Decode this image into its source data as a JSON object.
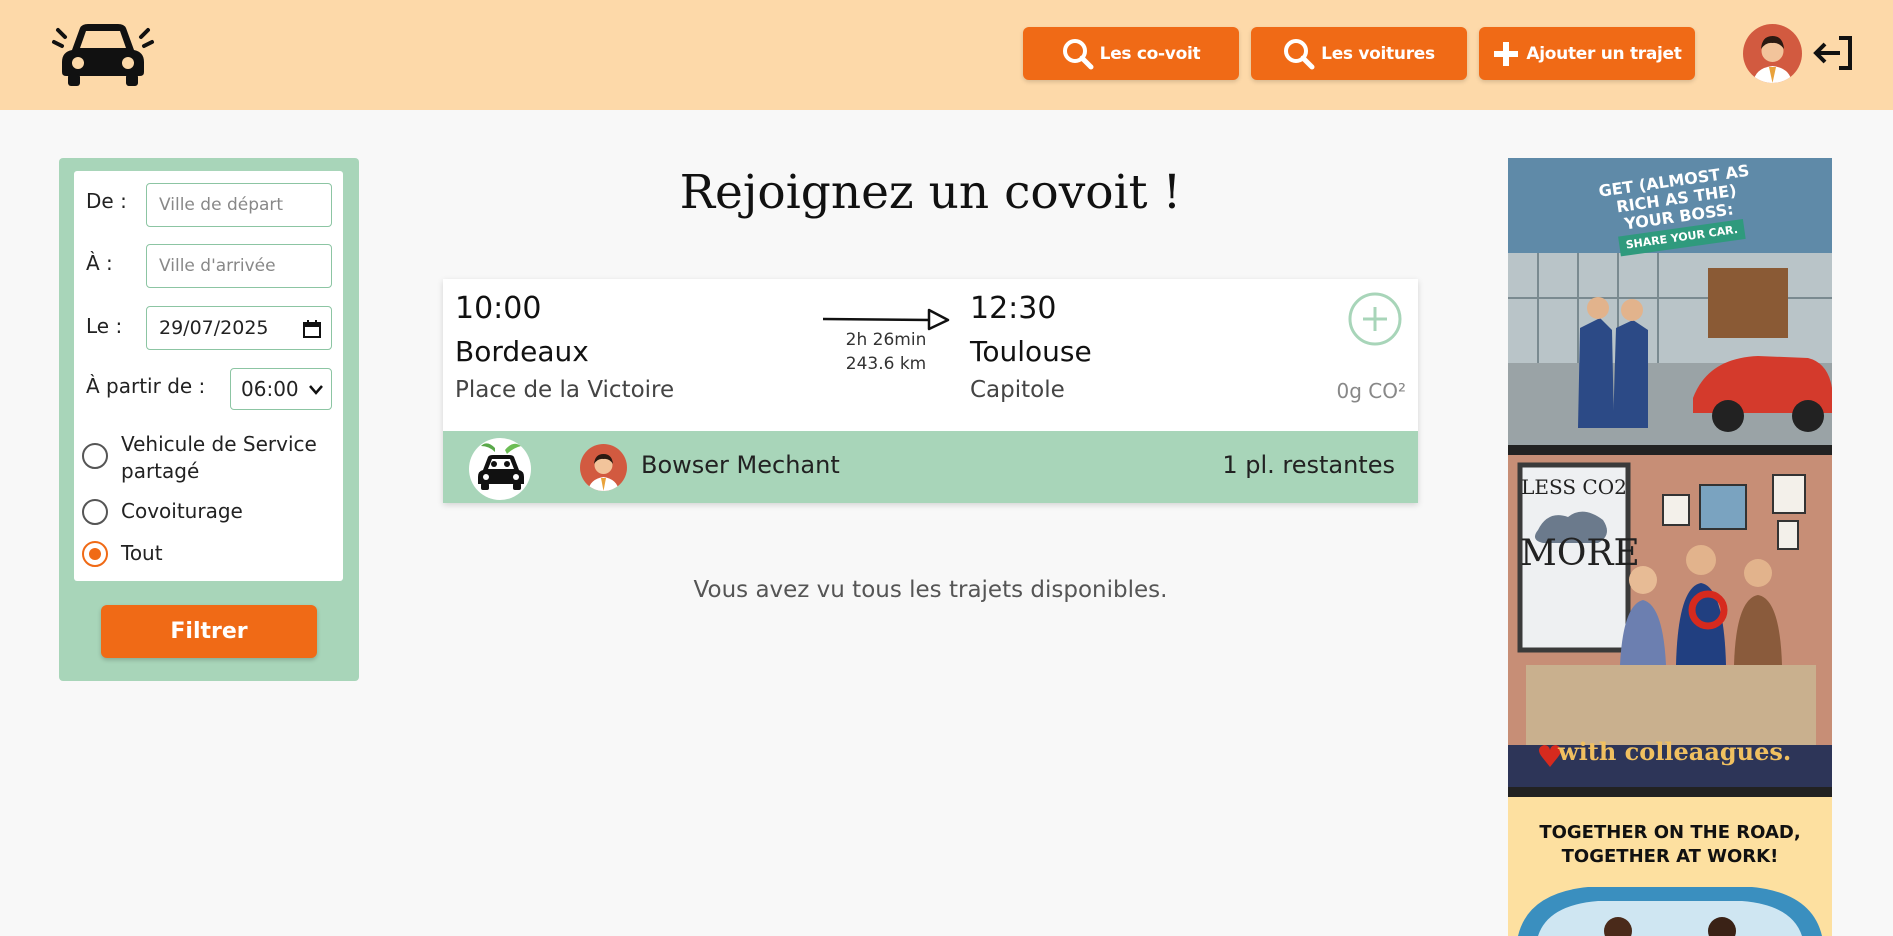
{
  "header": {
    "nav": [
      {
        "label": "Les co-voit",
        "icon": "search-icon"
      },
      {
        "label": "Les voitures",
        "icon": "search-icon"
      },
      {
        "label": "Ajouter un trajet",
        "icon": "plus-icon"
      }
    ]
  },
  "filters": {
    "from_label": "De :",
    "from_placeholder": "Ville de départ",
    "to_label": "À :",
    "to_placeholder": "Ville d'arrivée",
    "date_label": "Le :",
    "date_value": "29/07/2025",
    "time_label": "À partir de :",
    "time_value": "06:00",
    "options": [
      {
        "label_line1": "Vehicule de Service",
        "label_line2": "partagé",
        "checked": false
      },
      {
        "label": "Covoiturage",
        "checked": false
      },
      {
        "label": "Tout",
        "checked": true
      }
    ],
    "submit_label": "Filtrer"
  },
  "main": {
    "title": "Rejoignez un covoit !",
    "trips": [
      {
        "depart_time": "10:00",
        "depart_city": "Bordeaux",
        "depart_place": "Place de la Victoire",
        "duration": "2h 26min",
        "distance": "243.6 km",
        "arrival_time": "12:30",
        "arrival_city": "Toulouse",
        "arrival_place": "Capitole",
        "co2": "0g CO²",
        "driver": "Bowser Mechant",
        "seats": "1 pl. restantes"
      }
    ],
    "end_message": "Vous avez vu tous les trajets disponibles."
  },
  "ads": [
    {
      "lines": [
        "GET (ALMOST AS",
        "RICH AS THE)",
        "YOUR BOSS:"
      ],
      "subline": "SHARE YOUR CAR."
    },
    {
      "lines": [
        "LESS CO2",
        "MORE"
      ],
      "subline": "with colleaagues."
    },
    {
      "lines": [
        "TOGETHER ON THE ROAD,",
        "TOGETHER AT WORK!"
      ]
    }
  ],
  "colors": {
    "accent": "#f06a16",
    "header_bg": "#fdd9a9",
    "green": "#a8d5b9"
  }
}
